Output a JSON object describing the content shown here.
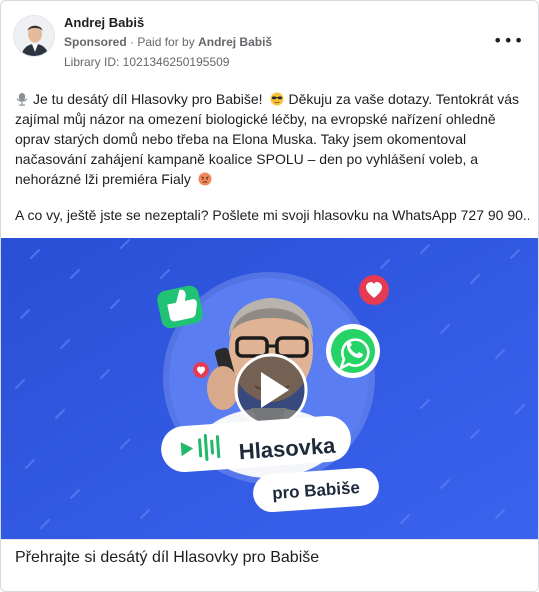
{
  "post": {
    "author": "Andrej Babiš",
    "sponsored": "Sponsored",
    "paid_prefix": "Paid for by",
    "paid_by": "Andrej Babiš",
    "library_id": "Library ID: 1021346250195509",
    "more_label": "•••",
    "text_line_1": "Je tu desátý díl Hlasovky pro Babiše!",
    "text_line_1b": "Děkuju za vaše dotazy. Tentokrát vás zajímal můj názor na omezení biologické léčby, na evropské nařízení ohledně oprav starých domů nebo třeba na Elona Muska. Taky jsem okomentoval načasování zahájení kampaně koalice SPOLU – den po vyhlášení voleb, a nehorázné lži premiéra Fialy",
    "text_line_2": "A co vy, ještě jste se nezeptali? Pošlete mi svoji hlasovku na WhatsApp 727 90 90..."
  },
  "media": {
    "badge_brand": "Hlasovka",
    "badge_sub": "pro Babiše"
  },
  "caption": "Přehrajte si desátý díl Hlasovky pro Babiše",
  "colors": {
    "media_bg": "#2e55e0",
    "whatsapp_green": "#25d366",
    "heart_red": "#e63a52"
  }
}
